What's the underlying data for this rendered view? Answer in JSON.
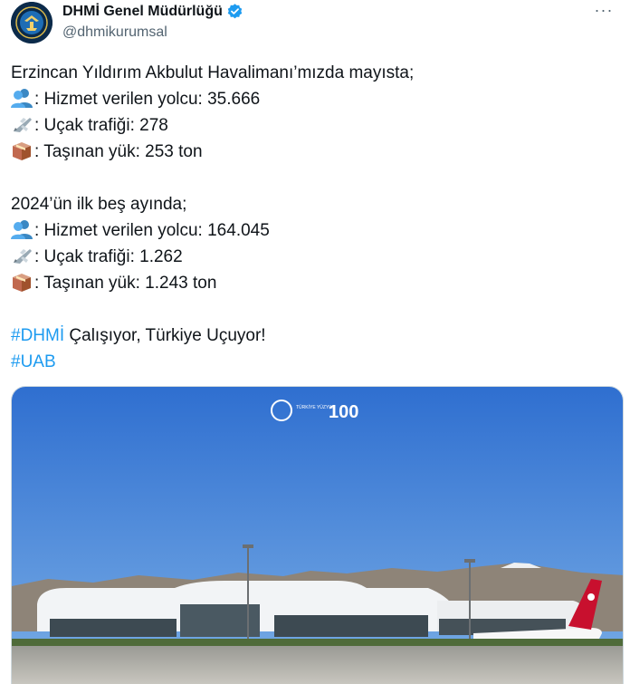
{
  "account": {
    "display_name": "DHMİ Genel Müdürlüğü",
    "handle": "@dhmikurumsal",
    "verified": true
  },
  "tweet": {
    "intro": "Erzincan Yıldırım Akbulut Havalimanı’mızda mayısta;",
    "may_stats": [
      {
        "icon": "passengers-icon",
        "text": ": Hizmet verilen yolcu: 35.666"
      },
      {
        "icon": "airplane-icon",
        "text": ": Uçak trafiği: 278"
      },
      {
        "icon": "cargo-box-icon",
        "text": ": Taşınan yük: 253 ton"
      }
    ],
    "ytd_intro": "2024’ün ilk beş ayında;",
    "ytd_stats": [
      {
        "icon": "passengers-icon",
        "text": ": Hizmet verilen yolcu: 164.045"
      },
      {
        "icon": "airplane-icon",
        "text": ": Uçak trafiği: 1.262"
      },
      {
        "icon": "cargo-box-icon",
        "text": ": Taşınan yük: 1.243 ton"
      }
    ],
    "closing_hashtag": "#DHMİ",
    "closing_text": " Çalışıyor, Türkiye Uçuyor!",
    "hashtag_2": "#UAB"
  },
  "media": {
    "logo_left_text": "TÜRKİYE YÜZYILI",
    "logo_right_text": "100"
  },
  "colors": {
    "link": "#1d9bf0",
    "verified": "#1d9bf0",
    "sky_top": "#2f6fd0",
    "sky_bottom": "#6fa6e3"
  }
}
